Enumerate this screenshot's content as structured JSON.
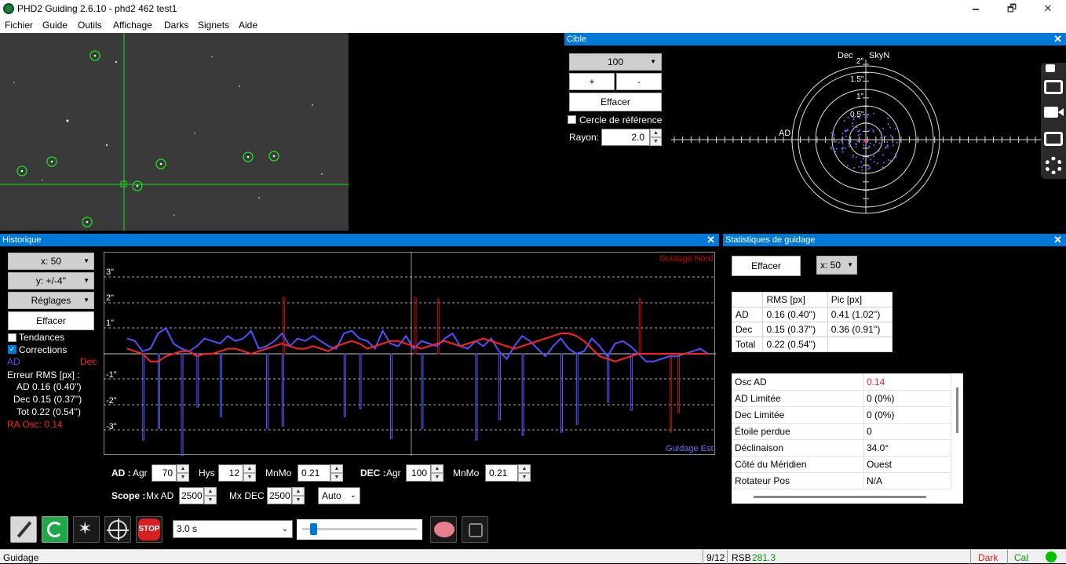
{
  "window": {
    "title": "PHD2 Guiding 2.6.10 - phd2 462 test1",
    "minimize": "🗕",
    "maximize": "🗗",
    "close": "✕"
  },
  "menu": [
    "Fichier",
    "Guide",
    "Outils",
    "Affichage",
    "Darks",
    "Signets",
    "Aide"
  ],
  "target_panel": {
    "title": "Cible",
    "zoom": "100",
    "plus": "+",
    "minus": "-",
    "clear": "Effacer",
    "ref_circle": "Cercle de référence",
    "radius_label": "Rayon:",
    "radius_value": "2.0",
    "dec_label": "Dec",
    "skyn_label": "SkyN",
    "ra_label": "AD",
    "ring_labels": [
      "2\"",
      "1.5\"",
      "1\"",
      "0.5\""
    ]
  },
  "history_panel": {
    "title": "Historique",
    "x_scale": "x: 50",
    "y_scale": "y: +/-4''",
    "settings": "Réglages",
    "clear": "Effacer",
    "trends": "Tendances",
    "corrections": "Corrections",
    "ra_legend": "AD",
    "dec_legend": "Dec",
    "rms_header": "Erreur RMS [px] :",
    "rms_ra": "AD  0.16 (0.40'')",
    "rms_dec": "Dec  0.15 (0.37'')",
    "rms_tot": "Tot  0.22 (0.54'')",
    "ra_osc": "RA Osc: 0.14",
    "guide_north": "Guidage Nord",
    "guide_east": "Guidage Est",
    "y_labels": [
      "3\"",
      "2\"",
      "1\"",
      "-1\"",
      "-2\"",
      "-3\""
    ]
  },
  "algo_controls": {
    "ra_label": "AD :",
    "agr1_label": "Agr",
    "agr1_value": "70",
    "hys_label": "Hys",
    "hys_value": "12",
    "mnmo1_label": "MnMo",
    "mnmo1_value": "0.21",
    "dec_label": "DEC :",
    "agr2_label": "Agr",
    "agr2_value": "100",
    "mnmo2_label": "MnMo",
    "mnmo2_value": "0.21",
    "scope_label": "Scope :",
    "mxad_label": "Mx AD",
    "mxad_value": "2500",
    "mxdec_label": "Mx DEC",
    "mxdec_value": "2500",
    "mode_value": "Auto"
  },
  "stats_panel": {
    "title": "Statistiques de guidage",
    "clear": "Effacer",
    "x_scale": "x: 50",
    "grid_headers": [
      "",
      "RMS [px]",
      "Pic [px]"
    ],
    "grid_rows": [
      [
        "AD",
        "0.16 (0.40'')",
        "0.41 (1.02'')"
      ],
      [
        "Dec",
        "0.15 (0.37'')",
        "0.36 (0.91'')"
      ],
      [
        "Total",
        "0.22 (0.54'')",
        ""
      ]
    ],
    "list": [
      [
        "Osc AD",
        "0.14"
      ],
      [
        "AD Limitée",
        "0 (0%)"
      ],
      [
        "Dec Limitée",
        "0 (0%)"
      ],
      [
        "Étoile perdue",
        "0"
      ],
      [
        "Déclinaison",
        "34.0°"
      ],
      [
        "Côté du Méridien",
        "Ouest"
      ],
      [
        "Rotateur Pos",
        "N/A"
      ]
    ]
  },
  "toolbar": {
    "exposure": "3.0 s",
    "stop": "STOP"
  },
  "status": {
    "state": "Guidage",
    "frame": "9/12",
    "snr_label": "RSB",
    "snr_value": "281.3",
    "dark": "Dark",
    "cal": "Cal"
  },
  "colors": {
    "accent": "#0078d7",
    "ra": "#5050ff",
    "dec": "#ff2020",
    "green": "#00c000"
  },
  "chart_data": {
    "type": "line",
    "ylim": [
      -4,
      4
    ],
    "series": [
      {
        "name": "AD",
        "values": [
          0.6,
          0.5,
          0.1,
          0.2,
          0.8,
          1.0,
          0.4,
          0.2,
          0.1,
          0.3,
          0.6,
          0.5,
          0.4,
          0.7,
          0.5,
          0.6,
          0.9,
          0.2,
          0.3,
          0.5,
          0.8,
          0.3,
          0.6,
          0.5,
          0.7,
          0.5,
          0.3,
          0.2,
          0.8,
          0.9,
          0.6,
          0.5,
          0.2,
          0.9,
          0.4,
          0.3,
          0.7,
          0.2,
          0.5,
          0.4,
          0.3,
          0.6,
          0.8,
          0.3,
          0.2,
          0.5,
          0.3,
          0.6,
          0.1,
          -0.2,
          0.3,
          0.7,
          0.5,
          0.2,
          -0.1,
          0.3,
          0.6,
          0.2,
          0.0,
          0.1,
          0.6,
          0.3,
          -0.1,
          0.4,
          0.5,
          0.3,
          0.0,
          -0.3,
          -0.3,
          -0.2,
          -0.1,
          -0.1,
          0.0,
          0.1,
          0.2,
          0.0
        ]
      },
      {
        "name": "Dec",
        "values": [
          0.2,
          0.1,
          0.0,
          -0.3,
          -0.3,
          -0.1,
          0.0,
          0.1,
          0.1,
          -0.1,
          0.0,
          0.0,
          0.1,
          0.2,
          0.2,
          0.1,
          0.0,
          0.1,
          0.2,
          0.3,
          0.4,
          0.3,
          0.2,
          0.2,
          0.3,
          0.2,
          0.1,
          0.3,
          0.4,
          0.5,
          0.4,
          0.2,
          0.3,
          0.4,
          0.5,
          0.5,
          0.4,
          0.3,
          0.2,
          0.3,
          0.4,
          0.5,
          0.4,
          0.3,
          0.4,
          0.5,
          0.6,
          0.5,
          0.4,
          0.3,
          0.2,
          0.3,
          0.4,
          0.5,
          0.6,
          0.7,
          0.8,
          0.8,
          0.7,
          0.5,
          0.2,
          -0.1,
          -0.2,
          -0.3,
          -0.2,
          -0.1,
          0.0,
          0.0,
          0.0,
          0.0,
          0.0,
          0.0,
          0.0,
          0.0,
          0.0,
          0.0
        ]
      }
    ]
  }
}
